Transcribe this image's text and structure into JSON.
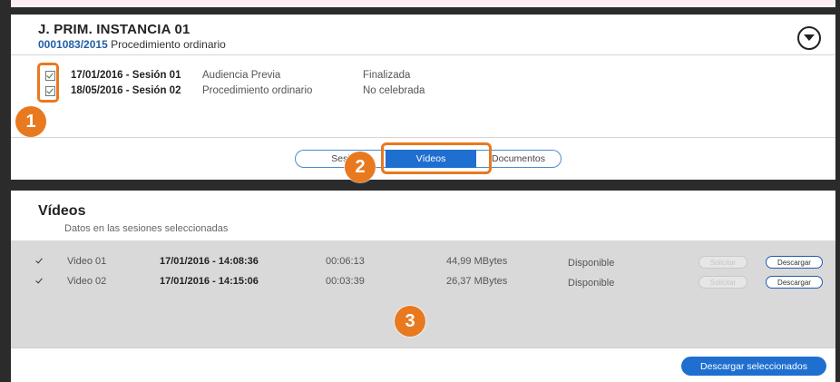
{
  "court": {
    "title": "J. PRIM. INSTANCIA 01",
    "case_number": "0001083/2015",
    "case_type": "Procedimiento ordinario"
  },
  "sessions": [
    {
      "checked": true,
      "date_session": "17/01/2016 - Sesión 01",
      "type": "Audiencia Previa",
      "status": "Finalizada"
    },
    {
      "checked": true,
      "date_session": "18/05/2016 - Sesión 02",
      "type": "Procedimiento ordinario",
      "status": "No celebrada"
    }
  ],
  "tabs": [
    {
      "label": "Sesiones",
      "visible_text": "Sesi",
      "active": false
    },
    {
      "label": "Vídeos",
      "active": true
    },
    {
      "label": "Documentos",
      "active": false
    }
  ],
  "videos_section": {
    "title": "Vídeos",
    "subtitle": "Datos en las sesiones seleccionadas",
    "rows": [
      {
        "checked": true,
        "name": "Video 01",
        "datetime": "17/01/2016 - 14:08:36",
        "duration": "00:06:13",
        "size": "44,99 MBytes",
        "availability": "Disponible",
        "request_label": "Solicitar",
        "download_label": "Descargar"
      },
      {
        "checked": true,
        "name": "Video 02",
        "datetime": "17/01/2016 - 14:15:06",
        "duration": "00:03:39",
        "size": "26,37 MBytes",
        "availability": "Disponible",
        "request_label": "Solicitar",
        "download_label": "Descargar"
      }
    ],
    "download_selected_label": "Descargar seleccionados"
  },
  "annotations": {
    "badge_1": "1",
    "badge_2": "2",
    "badge_3": "3"
  },
  "colors": {
    "accent_orange": "#e8791f",
    "primary_blue": "#1f6fd0",
    "case_blue": "#1f5fa8",
    "frame_dark": "#2b2b2b",
    "grid_gray": "#d9d9d9"
  },
  "icons": {
    "collapse": "chevron-down-circle-icon",
    "checkbox": "checkmark-icon"
  }
}
